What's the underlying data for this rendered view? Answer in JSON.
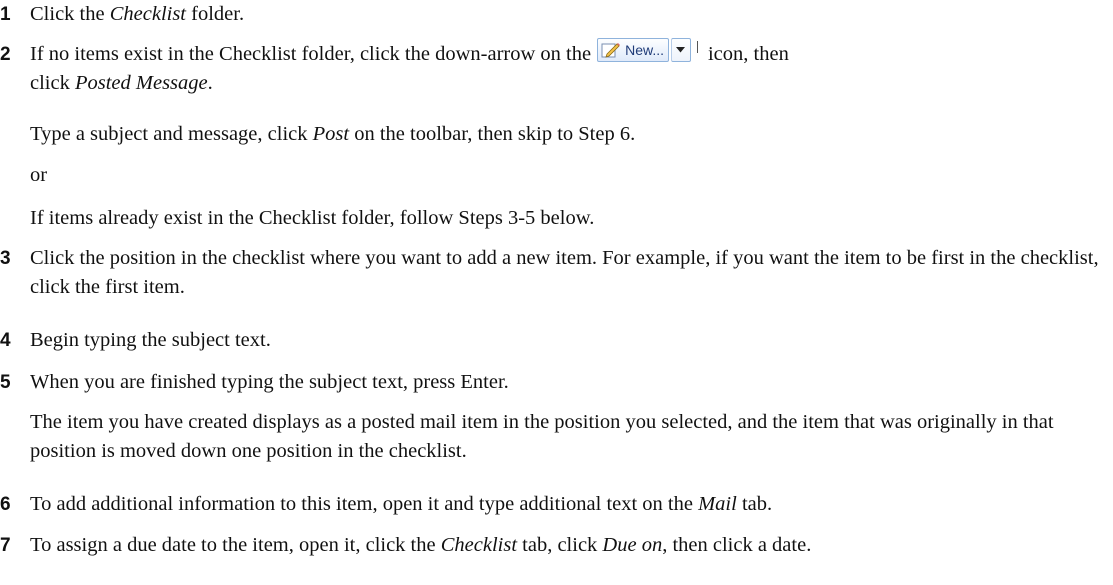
{
  "steps": [
    {
      "num": "1",
      "before": "Click the ",
      "em": "Checklist",
      "after": " folder."
    },
    {
      "num": "2",
      "before": "If no items exist in the Checklist folder, click the down-arrow on the",
      "after": "icon, then",
      "line2_before": "click ",
      "line2_em": "Posted Message",
      "line2_after": "."
    },
    {
      "num": "3",
      "text": "Click the position in the checklist where you want to add a new item. For example, if you want the item to be first in the checklist, click the first item."
    },
    {
      "num": "4",
      "text": "Begin typing the subject text."
    },
    {
      "num": "5",
      "text": "When you are finished typing the subject text, press Enter."
    },
    {
      "num": "6",
      "before": "To add additional information to this item, open it and type additional text on the ",
      "em": "Mail",
      "after": " tab."
    },
    {
      "num": "7",
      "before": "To assign a due date to the item, open it, click the ",
      "em1": "Checklist",
      "mid": " tab, click ",
      "em2": "Due on",
      "after": ", then click a date."
    }
  ],
  "step2_paras": {
    "p1_before": "Type a subject and message, click ",
    "p1_em": "Post",
    "p1_after": " on the toolbar, then skip to Step 6.",
    "or": "or",
    "p3": "If items already exist in the Checklist folder, follow Steps 3-5 below."
  },
  "step5_para": "The item you have created displays as a posted mail item in the position you selected, and the item that was originally in that position is moved down one position in the checklist.",
  "new_button": {
    "label": "New...",
    "icon": "pencil-paper-icon",
    "arrow_icon": "chevron-down-icon"
  }
}
